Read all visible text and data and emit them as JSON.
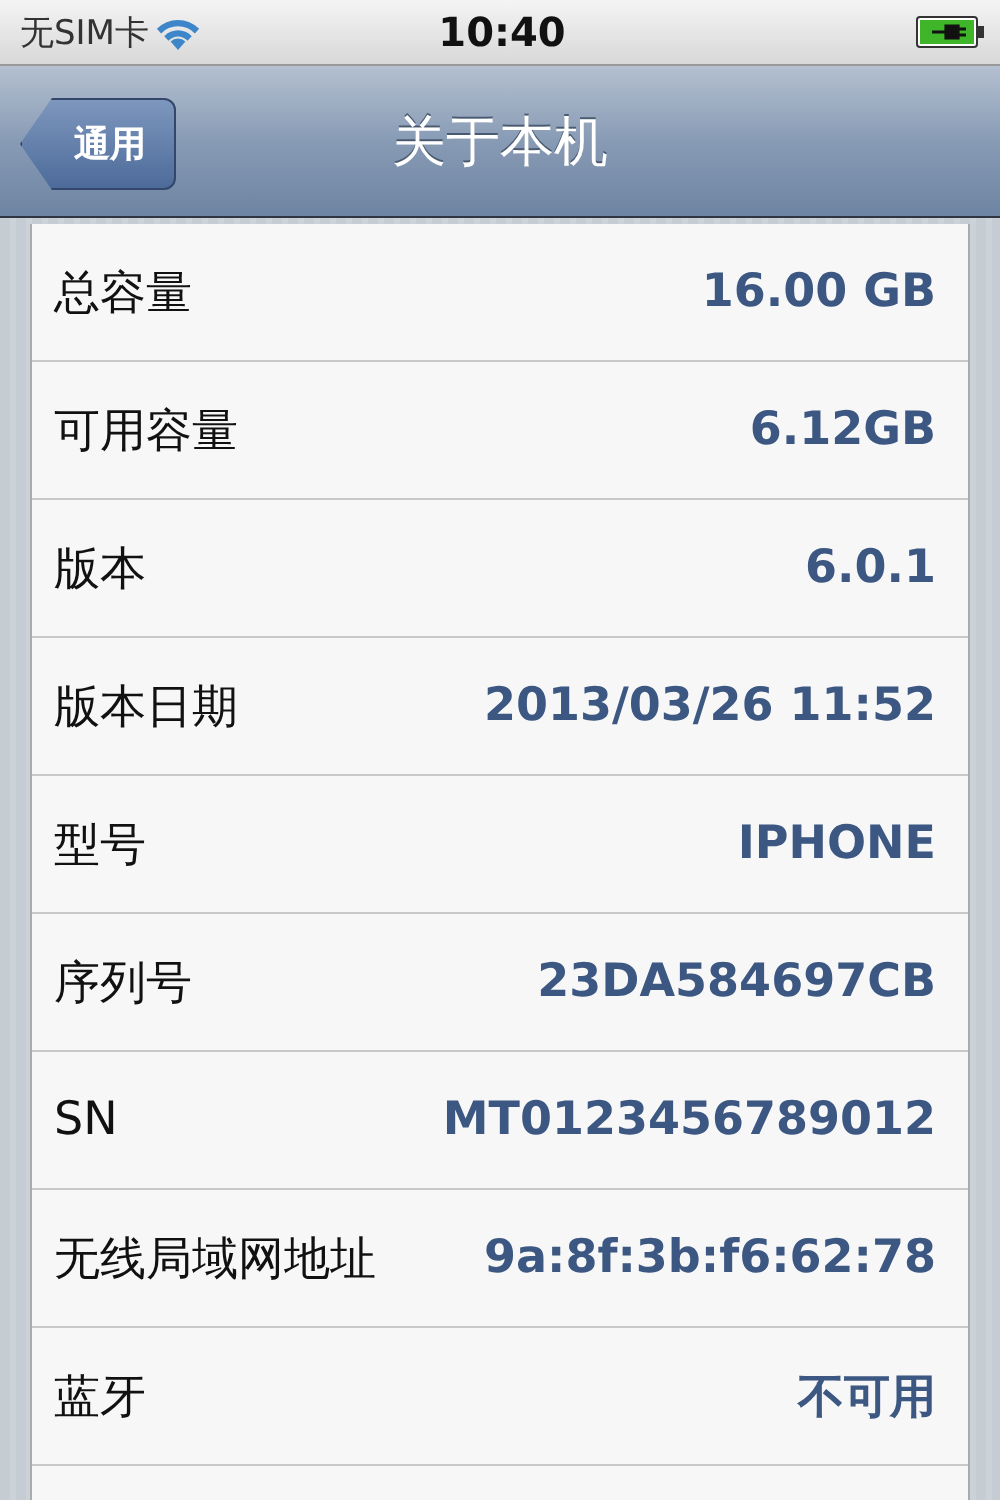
{
  "status_bar": {
    "carrier": "无SIM卡",
    "time": "10:40"
  },
  "nav_bar": {
    "back_button": "通用",
    "title": "关于本机"
  },
  "rows": [
    {
      "label": "总容量",
      "value": "16.00 GB"
    },
    {
      "label": "可用容量",
      "value": "6.12GB"
    },
    {
      "label": "版本",
      "value": "6.0.1"
    },
    {
      "label": "版本日期",
      "value": "2013/03/26 11:52"
    },
    {
      "label": "型号",
      "value": "IPHONE"
    },
    {
      "label": "序列号",
      "value": "23DA584697CB"
    },
    {
      "label": "SN",
      "value": "MT0123456789012"
    },
    {
      "label": "无线局域网地址",
      "value": "9a:8f:3b:f6:62:78"
    },
    {
      "label": "蓝牙",
      "value": "不可用"
    }
  ]
}
